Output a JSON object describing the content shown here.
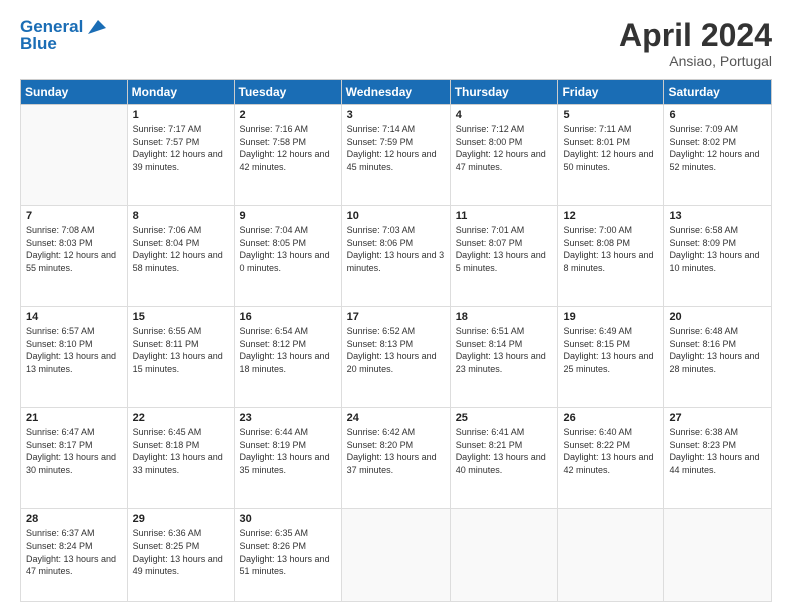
{
  "logo": {
    "line1": "General",
    "line2": "Blue"
  },
  "header": {
    "month": "April 2024",
    "location": "Ansiao, Portugal"
  },
  "weekdays": [
    "Sunday",
    "Monday",
    "Tuesday",
    "Wednesday",
    "Thursday",
    "Friday",
    "Saturday"
  ],
  "weeks": [
    [
      {
        "day": "",
        "sunrise": "",
        "sunset": "",
        "daylight": ""
      },
      {
        "day": "1",
        "sunrise": "Sunrise: 7:17 AM",
        "sunset": "Sunset: 7:57 PM",
        "daylight": "Daylight: 12 hours and 39 minutes."
      },
      {
        "day": "2",
        "sunrise": "Sunrise: 7:16 AM",
        "sunset": "Sunset: 7:58 PM",
        "daylight": "Daylight: 12 hours and 42 minutes."
      },
      {
        "day": "3",
        "sunrise": "Sunrise: 7:14 AM",
        "sunset": "Sunset: 7:59 PM",
        "daylight": "Daylight: 12 hours and 45 minutes."
      },
      {
        "day": "4",
        "sunrise": "Sunrise: 7:12 AM",
        "sunset": "Sunset: 8:00 PM",
        "daylight": "Daylight: 12 hours and 47 minutes."
      },
      {
        "day": "5",
        "sunrise": "Sunrise: 7:11 AM",
        "sunset": "Sunset: 8:01 PM",
        "daylight": "Daylight: 12 hours and 50 minutes."
      },
      {
        "day": "6",
        "sunrise": "Sunrise: 7:09 AM",
        "sunset": "Sunset: 8:02 PM",
        "daylight": "Daylight: 12 hours and 52 minutes."
      }
    ],
    [
      {
        "day": "7",
        "sunrise": "Sunrise: 7:08 AM",
        "sunset": "Sunset: 8:03 PM",
        "daylight": "Daylight: 12 hours and 55 minutes."
      },
      {
        "day": "8",
        "sunrise": "Sunrise: 7:06 AM",
        "sunset": "Sunset: 8:04 PM",
        "daylight": "Daylight: 12 hours and 58 minutes."
      },
      {
        "day": "9",
        "sunrise": "Sunrise: 7:04 AM",
        "sunset": "Sunset: 8:05 PM",
        "daylight": "Daylight: 13 hours and 0 minutes."
      },
      {
        "day": "10",
        "sunrise": "Sunrise: 7:03 AM",
        "sunset": "Sunset: 8:06 PM",
        "daylight": "Daylight: 13 hours and 3 minutes."
      },
      {
        "day": "11",
        "sunrise": "Sunrise: 7:01 AM",
        "sunset": "Sunset: 8:07 PM",
        "daylight": "Daylight: 13 hours and 5 minutes."
      },
      {
        "day": "12",
        "sunrise": "Sunrise: 7:00 AM",
        "sunset": "Sunset: 8:08 PM",
        "daylight": "Daylight: 13 hours and 8 minutes."
      },
      {
        "day": "13",
        "sunrise": "Sunrise: 6:58 AM",
        "sunset": "Sunset: 8:09 PM",
        "daylight": "Daylight: 13 hours and 10 minutes."
      }
    ],
    [
      {
        "day": "14",
        "sunrise": "Sunrise: 6:57 AM",
        "sunset": "Sunset: 8:10 PM",
        "daylight": "Daylight: 13 hours and 13 minutes."
      },
      {
        "day": "15",
        "sunrise": "Sunrise: 6:55 AM",
        "sunset": "Sunset: 8:11 PM",
        "daylight": "Daylight: 13 hours and 15 minutes."
      },
      {
        "day": "16",
        "sunrise": "Sunrise: 6:54 AM",
        "sunset": "Sunset: 8:12 PM",
        "daylight": "Daylight: 13 hours and 18 minutes."
      },
      {
        "day": "17",
        "sunrise": "Sunrise: 6:52 AM",
        "sunset": "Sunset: 8:13 PM",
        "daylight": "Daylight: 13 hours and 20 minutes."
      },
      {
        "day": "18",
        "sunrise": "Sunrise: 6:51 AM",
        "sunset": "Sunset: 8:14 PM",
        "daylight": "Daylight: 13 hours and 23 minutes."
      },
      {
        "day": "19",
        "sunrise": "Sunrise: 6:49 AM",
        "sunset": "Sunset: 8:15 PM",
        "daylight": "Daylight: 13 hours and 25 minutes."
      },
      {
        "day": "20",
        "sunrise": "Sunrise: 6:48 AM",
        "sunset": "Sunset: 8:16 PM",
        "daylight": "Daylight: 13 hours and 28 minutes."
      }
    ],
    [
      {
        "day": "21",
        "sunrise": "Sunrise: 6:47 AM",
        "sunset": "Sunset: 8:17 PM",
        "daylight": "Daylight: 13 hours and 30 minutes."
      },
      {
        "day": "22",
        "sunrise": "Sunrise: 6:45 AM",
        "sunset": "Sunset: 8:18 PM",
        "daylight": "Daylight: 13 hours and 33 minutes."
      },
      {
        "day": "23",
        "sunrise": "Sunrise: 6:44 AM",
        "sunset": "Sunset: 8:19 PM",
        "daylight": "Daylight: 13 hours and 35 minutes."
      },
      {
        "day": "24",
        "sunrise": "Sunrise: 6:42 AM",
        "sunset": "Sunset: 8:20 PM",
        "daylight": "Daylight: 13 hours and 37 minutes."
      },
      {
        "day": "25",
        "sunrise": "Sunrise: 6:41 AM",
        "sunset": "Sunset: 8:21 PM",
        "daylight": "Daylight: 13 hours and 40 minutes."
      },
      {
        "day": "26",
        "sunrise": "Sunrise: 6:40 AM",
        "sunset": "Sunset: 8:22 PM",
        "daylight": "Daylight: 13 hours and 42 minutes."
      },
      {
        "day": "27",
        "sunrise": "Sunrise: 6:38 AM",
        "sunset": "Sunset: 8:23 PM",
        "daylight": "Daylight: 13 hours and 44 minutes."
      }
    ],
    [
      {
        "day": "28",
        "sunrise": "Sunrise: 6:37 AM",
        "sunset": "Sunset: 8:24 PM",
        "daylight": "Daylight: 13 hours and 47 minutes."
      },
      {
        "day": "29",
        "sunrise": "Sunrise: 6:36 AM",
        "sunset": "Sunset: 8:25 PM",
        "daylight": "Daylight: 13 hours and 49 minutes."
      },
      {
        "day": "30",
        "sunrise": "Sunrise: 6:35 AM",
        "sunset": "Sunset: 8:26 PM",
        "daylight": "Daylight: 13 hours and 51 minutes."
      },
      {
        "day": "",
        "sunrise": "",
        "sunset": "",
        "daylight": ""
      },
      {
        "day": "",
        "sunrise": "",
        "sunset": "",
        "daylight": ""
      },
      {
        "day": "",
        "sunrise": "",
        "sunset": "",
        "daylight": ""
      },
      {
        "day": "",
        "sunrise": "",
        "sunset": "",
        "daylight": ""
      }
    ]
  ]
}
